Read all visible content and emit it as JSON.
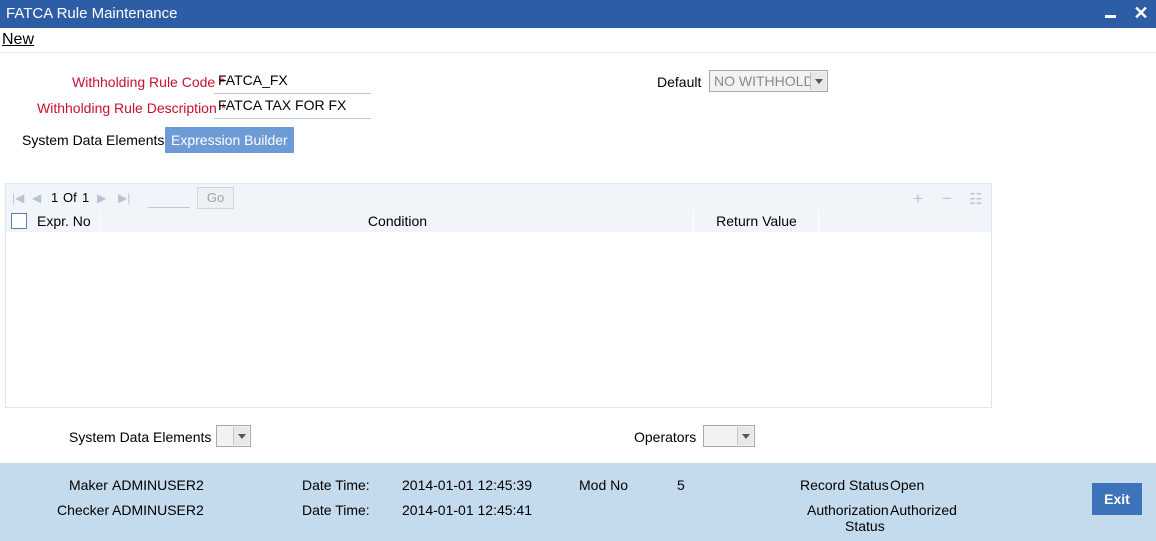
{
  "window": {
    "title": "FATCA Rule Maintenance",
    "minimize_icon": "minimize-icon",
    "close_icon": "close-icon"
  },
  "menu": {
    "new_label": "New"
  },
  "form": {
    "code_label": "Withholding Rule Code",
    "code_value": "FATCA_FX",
    "desc_label": "Withholding Rule Description",
    "desc_value": "FATCA TAX FOR FX",
    "required_mark": "*",
    "default_label": "Default",
    "default_value": "NO WITHHOLD"
  },
  "tabs": [
    {
      "label": "System Data Elements",
      "active": false
    },
    {
      "label": "Expression Builder",
      "active": true
    }
  ],
  "grid": {
    "page_current": "1",
    "page_of": "Of",
    "page_total": "1",
    "go_label": "Go",
    "columns": [
      "Expr. No",
      "Condition",
      "Return Value"
    ],
    "rows": []
  },
  "builder": {
    "sde_label": "System Data Elements",
    "operators_label": "Operators"
  },
  "footer": {
    "maker_label": "Maker",
    "maker_value": "ADMINUSER2",
    "checker_label": "Checker",
    "checker_value": "ADMINUSER2",
    "datetime_label": "Date Time:",
    "maker_datetime": "2014-01-01 12:45:39",
    "checker_datetime": "2014-01-01 12:45:41",
    "modno_label": "Mod No",
    "modno_value": "5",
    "record_status_label": "Record Status",
    "record_status_value": "Open",
    "auth_status_label_1": "Authorization",
    "auth_status_label_2": "Status",
    "auth_status_value": "Authorized",
    "exit_label": "Exit"
  },
  "colors": {
    "titlebar": "#2c5da5",
    "required_label": "#c8102e",
    "active_tab": "#6c9bd6",
    "footer_bg": "#c4dbee",
    "exit_button": "#3d73b8"
  }
}
